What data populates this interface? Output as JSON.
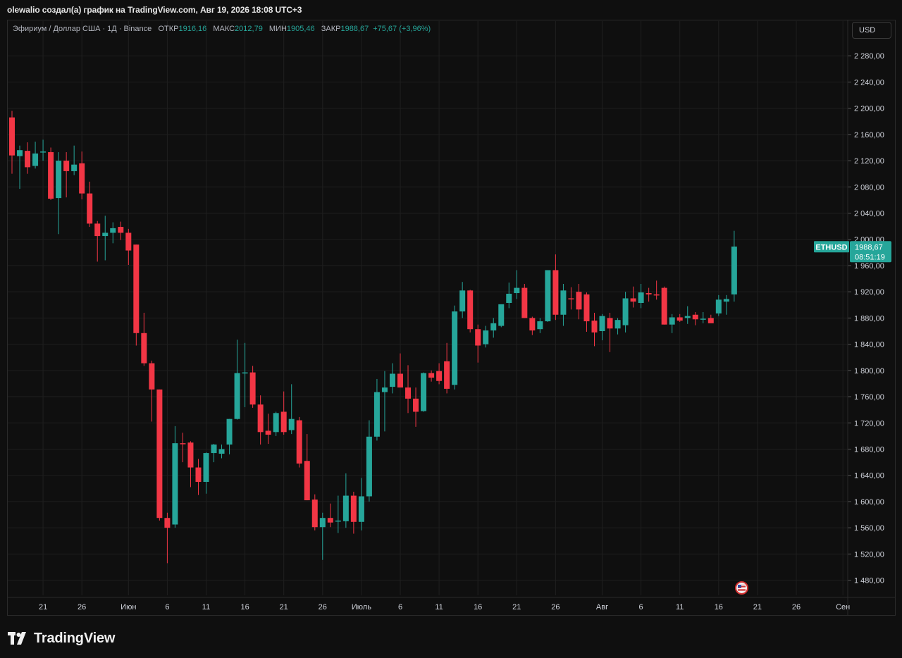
{
  "header": {
    "caption": "olewalio создал(а) график на TradingView.com, Авг 19, 2026 18:08 UTC+3"
  },
  "legend": {
    "symbol": "Эфириум / Доллар США · 1Д · Binance",
    "open_label": "ОТКР",
    "open_value": "1916,16",
    "high_label": "МАКС",
    "high_value": "2012,79",
    "low_label": "МИН",
    "low_value": "1905,46",
    "close_label": "ЗАКР",
    "close_value": "1988,67",
    "change_value": "+75,67 (+3,96%)"
  },
  "currency_button": {
    "label": "USD"
  },
  "price_tag": {
    "ticker": "ETHUSD",
    "price": "1988,67",
    "countdown": "08:51:19"
  },
  "branding": {
    "name": "TradingView"
  },
  "colors": {
    "up": "#26a69a",
    "down": "#f23645",
    "background": "#0f0f0f",
    "grid": "#1f1f1f",
    "axis_text": "#d1d4dc"
  },
  "chart_data": {
    "type": "candlestick",
    "symbol": "ETHUSD",
    "interval": "1Д",
    "exchange": "Binance",
    "ylim": [
      1457,
      2306
    ],
    "y_ticks": [
      {
        "value": 1480,
        "label": "1 480,00"
      },
      {
        "value": 1520,
        "label": "1 520,00"
      },
      {
        "value": 1560,
        "label": "1 560,00"
      },
      {
        "value": 1600,
        "label": "1 600,00"
      },
      {
        "value": 1640,
        "label": "1 640,00"
      },
      {
        "value": 1680,
        "label": "1 680,00"
      },
      {
        "value": 1720,
        "label": "1 720,00"
      },
      {
        "value": 1760,
        "label": "1 760,00"
      },
      {
        "value": 1800,
        "label": "1 800,00"
      },
      {
        "value": 1840,
        "label": "1 840,00"
      },
      {
        "value": 1880,
        "label": "1 880,00"
      },
      {
        "value": 1920,
        "label": "1 920,00"
      },
      {
        "value": 1960,
        "label": "1 960,00"
      },
      {
        "value": 2000,
        "label": "2 000,00"
      },
      {
        "value": 2040,
        "label": "2 040,00"
      },
      {
        "value": 2080,
        "label": "2 080,00"
      },
      {
        "value": 2120,
        "label": "2 120,00"
      },
      {
        "value": 2160,
        "label": "2 160,00"
      },
      {
        "value": 2200,
        "label": "2 200,00"
      },
      {
        "value": 2240,
        "label": "2 240,00"
      },
      {
        "value": 2280,
        "label": "2 280,00"
      }
    ],
    "x_ticks": [
      {
        "index": 4,
        "label": "21"
      },
      {
        "index": 9,
        "label": "26"
      },
      {
        "index": 15,
        "label": "Июн"
      },
      {
        "index": 20,
        "label": "6"
      },
      {
        "index": 25,
        "label": "11"
      },
      {
        "index": 30,
        "label": "16"
      },
      {
        "index": 35,
        "label": "21"
      },
      {
        "index": 40,
        "label": "26"
      },
      {
        "index": 45,
        "label": "Июль"
      },
      {
        "index": 50,
        "label": "6"
      },
      {
        "index": 55,
        "label": "11"
      },
      {
        "index": 60,
        "label": "16"
      },
      {
        "index": 65,
        "label": "21"
      },
      {
        "index": 70,
        "label": "26"
      },
      {
        "index": 76,
        "label": "Авг"
      },
      {
        "index": 81,
        "label": "6"
      },
      {
        "index": 86,
        "label": "11"
      },
      {
        "index": 91,
        "label": "16"
      },
      {
        "index": 96,
        "label": "21"
      },
      {
        "index": 101,
        "label": "26"
      },
      {
        "index": 107,
        "label": "Сен"
      }
    ],
    "last_price": 1988.67,
    "candles": [
      {
        "o": 2186,
        "h": 2196,
        "l": 2100,
        "c": 2128
      },
      {
        "o": 2127,
        "h": 2143,
        "l": 2077,
        "c": 2136
      },
      {
        "o": 2135,
        "h": 2148,
        "l": 2100,
        "c": 2110
      },
      {
        "o": 2112,
        "h": 2149,
        "l": 2108,
        "c": 2131
      },
      {
        "o": 2133,
        "h": 2152,
        "l": 2120,
        "c": 2134
      },
      {
        "o": 2133,
        "h": 2140,
        "l": 2060,
        "c": 2062
      },
      {
        "o": 2063,
        "h": 2133,
        "l": 2008,
        "c": 2120
      },
      {
        "o": 2120,
        "h": 2133,
        "l": 2064,
        "c": 2104
      },
      {
        "o": 2104,
        "h": 2143,
        "l": 2098,
        "c": 2114
      },
      {
        "o": 2116,
        "h": 2134,
        "l": 2061,
        "c": 2070
      },
      {
        "o": 2070,
        "h": 2088,
        "l": 2019,
        "c": 2024
      },
      {
        "o": 2024,
        "h": 2028,
        "l": 1966,
        "c": 2005
      },
      {
        "o": 2005,
        "h": 2036,
        "l": 1968,
        "c": 2010
      },
      {
        "o": 2010,
        "h": 2026,
        "l": 1994,
        "c": 2017
      },
      {
        "o": 2019,
        "h": 2027,
        "l": 1999,
        "c": 2010
      },
      {
        "o": 2010,
        "h": 2016,
        "l": 1961,
        "c": 1983
      },
      {
        "o": 1992,
        "h": 1992,
        "l": 1838,
        "c": 1857
      },
      {
        "o": 1857,
        "h": 1888,
        "l": 1807,
        "c": 1811
      },
      {
        "o": 1811,
        "h": 1815,
        "l": 1722,
        "c": 1771
      },
      {
        "o": 1771,
        "h": 1771,
        "l": 1571,
        "c": 1575
      },
      {
        "o": 1575,
        "h": 1583,
        "l": 1506,
        "c": 1560
      },
      {
        "o": 1565,
        "h": 1715,
        "l": 1560,
        "c": 1689
      },
      {
        "o": 1689,
        "h": 1705,
        "l": 1660,
        "c": 1688
      },
      {
        "o": 1690,
        "h": 1692,
        "l": 1622,
        "c": 1652
      },
      {
        "o": 1652,
        "h": 1665,
        "l": 1610,
        "c": 1630
      },
      {
        "o": 1630,
        "h": 1675,
        "l": 1612,
        "c": 1674
      },
      {
        "o": 1674,
        "h": 1688,
        "l": 1660,
        "c": 1687
      },
      {
        "o": 1673,
        "h": 1687,
        "l": 1666,
        "c": 1680
      },
      {
        "o": 1687,
        "h": 1726,
        "l": 1672,
        "c": 1726
      },
      {
        "o": 1726,
        "h": 1847,
        "l": 1725,
        "c": 1796
      },
      {
        "o": 1797,
        "h": 1842,
        "l": 1744,
        "c": 1797
      },
      {
        "o": 1797,
        "h": 1807,
        "l": 1743,
        "c": 1748
      },
      {
        "o": 1748,
        "h": 1762,
        "l": 1687,
        "c": 1706
      },
      {
        "o": 1708,
        "h": 1734,
        "l": 1688,
        "c": 1702
      },
      {
        "o": 1706,
        "h": 1737,
        "l": 1700,
        "c": 1735
      },
      {
        "o": 1737,
        "h": 1768,
        "l": 1702,
        "c": 1706
      },
      {
        "o": 1709,
        "h": 1779,
        "l": 1703,
        "c": 1726
      },
      {
        "o": 1724,
        "h": 1729,
        "l": 1652,
        "c": 1658
      },
      {
        "o": 1662,
        "h": 1703,
        "l": 1602,
        "c": 1602
      },
      {
        "o": 1603,
        "h": 1611,
        "l": 1556,
        "c": 1561
      },
      {
        "o": 1561,
        "h": 1583,
        "l": 1511,
        "c": 1575
      },
      {
        "o": 1575,
        "h": 1597,
        "l": 1561,
        "c": 1568
      },
      {
        "o": 1571,
        "h": 1609,
        "l": 1552,
        "c": 1571
      },
      {
        "o": 1570,
        "h": 1643,
        "l": 1560,
        "c": 1609
      },
      {
        "o": 1609,
        "h": 1615,
        "l": 1551,
        "c": 1569
      },
      {
        "o": 1569,
        "h": 1636,
        "l": 1556,
        "c": 1608
      },
      {
        "o": 1608,
        "h": 1724,
        "l": 1600,
        "c": 1699
      },
      {
        "o": 1699,
        "h": 1787,
        "l": 1693,
        "c": 1767
      },
      {
        "o": 1767,
        "h": 1799,
        "l": 1707,
        "c": 1774
      },
      {
        "o": 1775,
        "h": 1811,
        "l": 1765,
        "c": 1795
      },
      {
        "o": 1795,
        "h": 1826,
        "l": 1781,
        "c": 1774
      },
      {
        "o": 1774,
        "h": 1808,
        "l": 1735,
        "c": 1757
      },
      {
        "o": 1757,
        "h": 1774,
        "l": 1714,
        "c": 1737
      },
      {
        "o": 1738,
        "h": 1797,
        "l": 1737,
        "c": 1796
      },
      {
        "o": 1796,
        "h": 1800,
        "l": 1783,
        "c": 1789
      },
      {
        "o": 1799,
        "h": 1811,
        "l": 1779,
        "c": 1784
      },
      {
        "o": 1814,
        "h": 1842,
        "l": 1765,
        "c": 1772
      },
      {
        "o": 1778,
        "h": 1899,
        "l": 1771,
        "c": 1890
      },
      {
        "o": 1890,
        "h": 1935,
        "l": 1880,
        "c": 1922
      },
      {
        "o": 1922,
        "h": 1923,
        "l": 1858,
        "c": 1863
      },
      {
        "o": 1863,
        "h": 1870,
        "l": 1812,
        "c": 1838
      },
      {
        "o": 1840,
        "h": 1868,
        "l": 1835,
        "c": 1861
      },
      {
        "o": 1861,
        "h": 1880,
        "l": 1850,
        "c": 1872
      },
      {
        "o": 1868,
        "h": 1900,
        "l": 1866,
        "c": 1901
      },
      {
        "o": 1903,
        "h": 1934,
        "l": 1895,
        "c": 1917
      },
      {
        "o": 1918,
        "h": 1953,
        "l": 1909,
        "c": 1926
      },
      {
        "o": 1926,
        "h": 1932,
        "l": 1880,
        "c": 1880
      },
      {
        "o": 1880,
        "h": 1882,
        "l": 1854,
        "c": 1861
      },
      {
        "o": 1863,
        "h": 1880,
        "l": 1857,
        "c": 1875
      },
      {
        "o": 1875,
        "h": 1953,
        "l": 1874,
        "c": 1953
      },
      {
        "o": 1953,
        "h": 1977,
        "l": 1877,
        "c": 1885
      },
      {
        "o": 1885,
        "h": 1932,
        "l": 1868,
        "c": 1922
      },
      {
        "o": 1910,
        "h": 1927,
        "l": 1893,
        "c": 1909
      },
      {
        "o": 1920,
        "h": 1932,
        "l": 1878,
        "c": 1893
      },
      {
        "o": 1916,
        "h": 1919,
        "l": 1859,
        "c": 1875
      },
      {
        "o": 1876,
        "h": 1888,
        "l": 1837,
        "c": 1858
      },
      {
        "o": 1860,
        "h": 1886,
        "l": 1846,
        "c": 1883
      },
      {
        "o": 1880,
        "h": 1888,
        "l": 1828,
        "c": 1864
      },
      {
        "o": 1864,
        "h": 1880,
        "l": 1855,
        "c": 1877
      },
      {
        "o": 1869,
        "h": 1920,
        "l": 1858,
        "c": 1910
      },
      {
        "o": 1910,
        "h": 1928,
        "l": 1896,
        "c": 1905
      },
      {
        "o": 1903,
        "h": 1932,
        "l": 1895,
        "c": 1919
      },
      {
        "o": 1918,
        "h": 1926,
        "l": 1905,
        "c": 1916
      },
      {
        "o": 1916,
        "h": 1937,
        "l": 1908,
        "c": 1915
      },
      {
        "o": 1926,
        "h": 1928,
        "l": 1870,
        "c": 1870
      },
      {
        "o": 1870,
        "h": 1886,
        "l": 1857,
        "c": 1881
      },
      {
        "o": 1881,
        "h": 1886,
        "l": 1874,
        "c": 1876
      },
      {
        "o": 1880,
        "h": 1898,
        "l": 1871,
        "c": 1883
      },
      {
        "o": 1885,
        "h": 1889,
        "l": 1869,
        "c": 1878
      },
      {
        "o": 1878,
        "h": 1889,
        "l": 1872,
        "c": 1879
      },
      {
        "o": 1880,
        "h": 1885,
        "l": 1874,
        "c": 1872
      },
      {
        "o": 1887,
        "h": 1915,
        "l": 1883,
        "c": 1908
      },
      {
        "o": 1905,
        "h": 1915,
        "l": 1885,
        "c": 1909
      },
      {
        "o": 1916,
        "h": 2013,
        "l": 1905,
        "c": 1989
      }
    ]
  }
}
